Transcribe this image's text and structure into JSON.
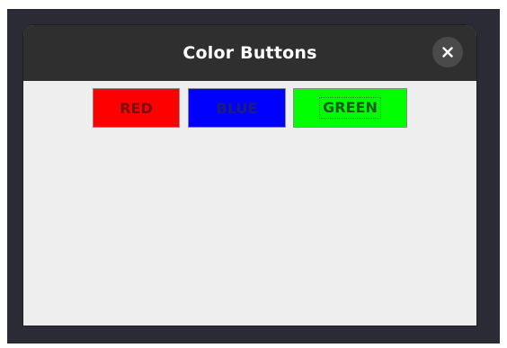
{
  "window": {
    "title": "Color Buttons",
    "close_icon": "close-icon"
  },
  "buttons": [
    {
      "label": "RED",
      "bg": "#ff0000",
      "fg": "#7a1010"
    },
    {
      "label": "BLUE",
      "bg": "#0000ff",
      "fg": "#1c1c7a"
    },
    {
      "label": "GREEN",
      "bg": "#00ff00",
      "fg": "#1a5a1a",
      "focused": true
    }
  ]
}
